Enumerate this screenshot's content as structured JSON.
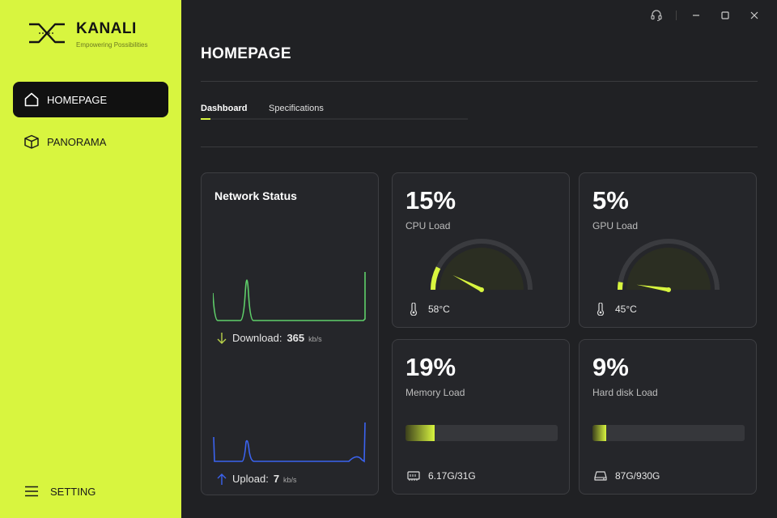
{
  "brand": {
    "name": "KANALI",
    "tagline": "Empowering Possibilities",
    "accent": "#d8f53f"
  },
  "sidebar": {
    "items": [
      {
        "label": "HOMEPAGE",
        "icon": "home-icon",
        "active": true
      },
      {
        "label": "PANORAMA",
        "icon": "box-icon",
        "active": false
      }
    ],
    "setting_label": "SETTING"
  },
  "window_controls": [
    "headset-icon",
    "minimize-icon",
    "maximize-icon",
    "close-icon"
  ],
  "page": {
    "title": "HOMEPAGE",
    "tabs": [
      {
        "label": "Dashboard",
        "active": true
      },
      {
        "label": "Specifications",
        "active": false
      }
    ]
  },
  "network": {
    "title": "Network Status",
    "download_label": "Download:",
    "download_value": "365",
    "download_unit": "kb/s",
    "upload_label": "Upload:",
    "upload_value": "7",
    "upload_unit": "kb/s",
    "download_color": "#5fcf6a",
    "upload_color": "#3b63f0"
  },
  "metrics": {
    "cpu": {
      "percent": "15%",
      "label": "CPU Load",
      "temp": "58°C",
      "value": 15
    },
    "gpu": {
      "percent": "5%",
      "label": "GPU Load",
      "temp": "45°C",
      "value": 5
    },
    "memory": {
      "percent": "19%",
      "label": "Memory Load",
      "usage": "6.17G/31G",
      "value": 19
    },
    "disk": {
      "percent": "9%",
      "label": "Hard disk Load",
      "usage": "87G/930G",
      "value": 9
    }
  }
}
